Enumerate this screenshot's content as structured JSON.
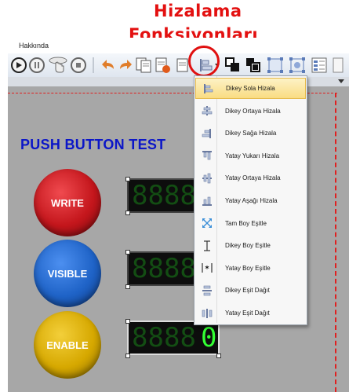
{
  "overlay": {
    "title_line1": "Hizalama",
    "title_line2": "Fonksiyonları"
  },
  "menubar": {
    "item_label": "Hakkında"
  },
  "canvas": {
    "title": "PUSH BUTTON TEST",
    "buttons": [
      {
        "label": "WRITE",
        "color": "#c4161c"
      },
      {
        "label": "VISIBLE",
        "color": "#1f63c7"
      },
      {
        "label": "ENABLE",
        "color": "#d6a800"
      }
    ],
    "displays": [
      {
        "digits": "88888"
      },
      {
        "digits": "88888"
      },
      {
        "digits": "88880"
      }
    ]
  },
  "menu": {
    "items": [
      {
        "label": "Dikey Sola Hizala",
        "icon": "align-left-icon"
      },
      {
        "label": "Dikey Ortaya Hizala",
        "icon": "align-center-vertical-icon"
      },
      {
        "label": "Dikey Sağa Hizala",
        "icon": "align-right-icon"
      },
      {
        "label": "Yatay Yukarı Hizala",
        "icon": "align-top-icon"
      },
      {
        "label": "Yatay Ortaya Hizala",
        "icon": "align-middle-horizontal-icon"
      },
      {
        "label": "Yatay Aşağı Hizala",
        "icon": "align-bottom-icon"
      },
      {
        "label": "Tam Boy Eşitle",
        "icon": "same-size-icon"
      },
      {
        "label": "Dikey Boy Eşitle",
        "icon": "same-height-icon"
      },
      {
        "label": "Yatay Boy Eşitle",
        "icon": "same-width-icon"
      },
      {
        "label": "Dikey Eşit Dağıt",
        "icon": "distribute-vertical-icon"
      },
      {
        "label": "Yatay Eşit Dağıt",
        "icon": "distribute-horizontal-icon"
      }
    ],
    "selected_index": 0
  },
  "colors": {
    "accent_red": "#e31010",
    "title_blue": "#0b16c8",
    "workspace_gray": "#a7a7a7",
    "segment_on": "#33ff33"
  }
}
